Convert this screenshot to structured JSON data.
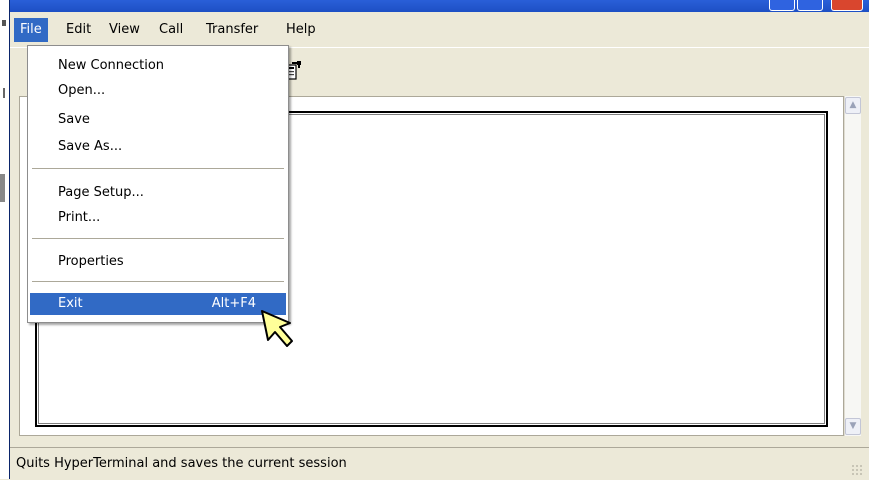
{
  "menubar": {
    "items": [
      "File",
      "Edit",
      "View",
      "Call",
      "Transfer",
      "Help"
    ],
    "active": "File"
  },
  "file_menu": {
    "items": [
      {
        "label": "New Connection"
      },
      {
        "label": "Open..."
      },
      {
        "label": "Save"
      },
      {
        "label": "Save As..."
      },
      {
        "label": "Page Setup..."
      },
      {
        "label": "Print..."
      },
      {
        "label": "Properties"
      },
      {
        "label": "Exit",
        "shortcut": "Alt+F4",
        "highlighted": true
      }
    ]
  },
  "toolbar": {
    "icons": [
      "properties-icon"
    ]
  },
  "status": {
    "text": "Quits HyperTerminal and saves the current session"
  },
  "colors": {
    "menu_highlight": "#316ac5",
    "window_bg": "#ece9d8",
    "cursor_fill": "#ffff99"
  }
}
